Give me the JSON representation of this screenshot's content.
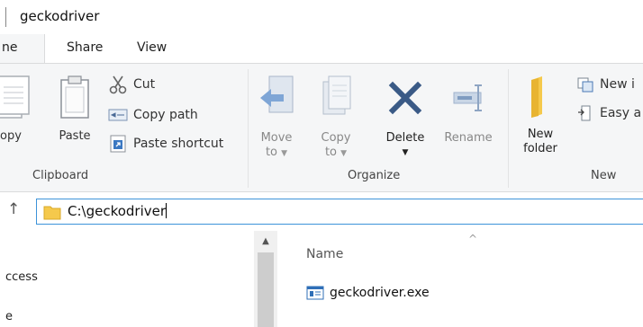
{
  "window": {
    "title": "geckodriver"
  },
  "tabs": [
    {
      "label": "ne"
    },
    {
      "label": "Share"
    },
    {
      "label": "View"
    }
  ],
  "ribbon": {
    "clipboard": {
      "label": "Clipboard",
      "copy": "opy",
      "paste": "Paste",
      "cut": "Cut",
      "copy_path": "Copy path",
      "paste_shortcut": "Paste shortcut"
    },
    "organize": {
      "label": "Organize",
      "move_to": [
        "Move",
        "to"
      ],
      "copy_to": [
        "Copy",
        "to"
      ],
      "delete": "Delete",
      "rename": "Rename"
    },
    "new": {
      "label": "New",
      "new_folder": [
        "New",
        "folder"
      ],
      "new_item": "New i",
      "easy_access": "Easy a"
    }
  },
  "address": {
    "path": "C:\\geckodriver"
  },
  "nav": {
    "items": [
      "ccess",
      "e"
    ]
  },
  "content": {
    "column_name": "Name",
    "files": [
      {
        "name": "geckodriver.exe"
      }
    ]
  },
  "colors": {
    "accent": "#3d93d9",
    "folder": "#f5c94c",
    "blue_icon": "#2f6fb7",
    "ribbon_bg": "#f5f6f7"
  }
}
